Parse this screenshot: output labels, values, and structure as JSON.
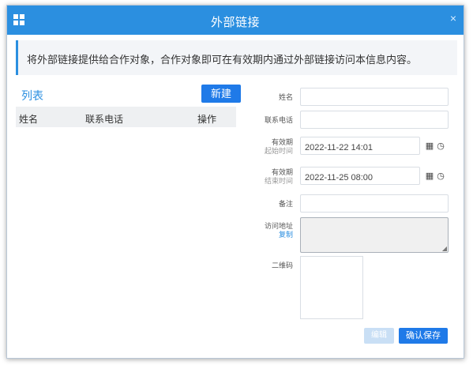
{
  "dialog": {
    "title": "外部链接",
    "close_glyph": "×"
  },
  "notice": "将外部链接提供给合作对象，合作对象即可在有效期内通过外部链接访问本信息内容。",
  "list": {
    "title": "列表",
    "new_button": "新建",
    "columns": [
      "姓名",
      "联系电话",
      "操作"
    ],
    "rows": []
  },
  "form": {
    "name_label": "姓名",
    "name_value": "",
    "phone_label": "联系电话",
    "phone_value": "",
    "start": {
      "label": "有效期",
      "sublabel": "起始时间",
      "value": "2022-11-22 14:01"
    },
    "end": {
      "label": "有效期",
      "sublabel": "结束时间",
      "value": "2022-11-25 08:00"
    },
    "remark_label": "备注",
    "remark_value": "",
    "url_label": "访问地址",
    "url_copy": "复制",
    "url_value": "",
    "qr_label": "二维码"
  },
  "icons": {
    "calendar": "▦",
    "clock": "◷",
    "resize": "◢"
  },
  "footer": {
    "edit_button": "编辑",
    "save_button": "确认保存"
  },
  "colors": {
    "accent": "#2b8fe0",
    "primary_button": "#1f7ae8",
    "disabled_button": "#c9dff5",
    "header_bg": "#eef0f2"
  }
}
